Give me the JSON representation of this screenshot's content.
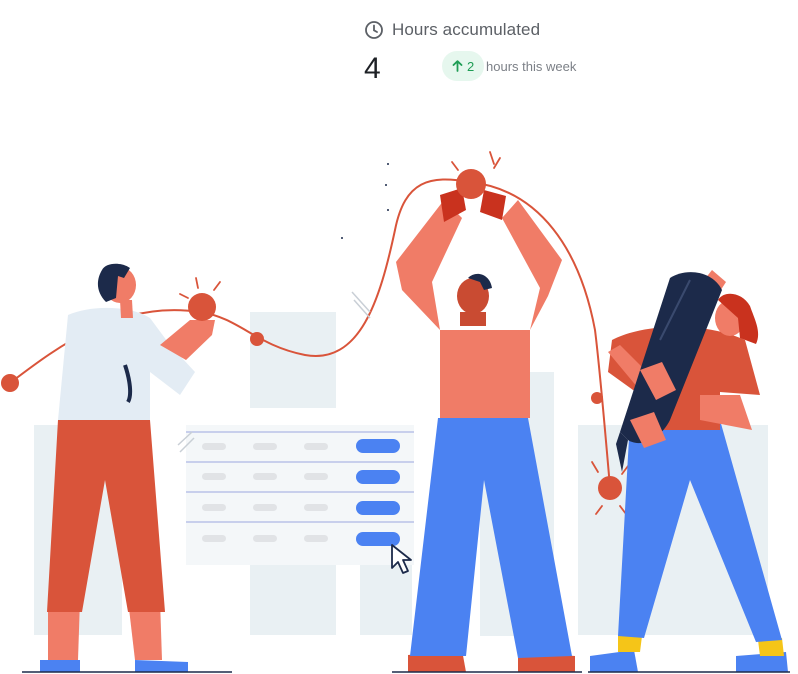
{
  "stat": {
    "label": "Hours accumulated",
    "value": "4",
    "delta": "2",
    "delta_suffix": "hours this week",
    "icon": "clock-icon",
    "delta_icon": "arrow-up-icon"
  },
  "colors": {
    "label": "#5c6066",
    "value": "#1e2126",
    "badge_bg": "#e6f7ee",
    "badge_fg": "#1f9d55",
    "orange": "#d9543a",
    "salmon": "#f07c67",
    "blue": "#4b82f2",
    "navy": "#1c2a4a",
    "bg_block": "#e9f0f3"
  }
}
